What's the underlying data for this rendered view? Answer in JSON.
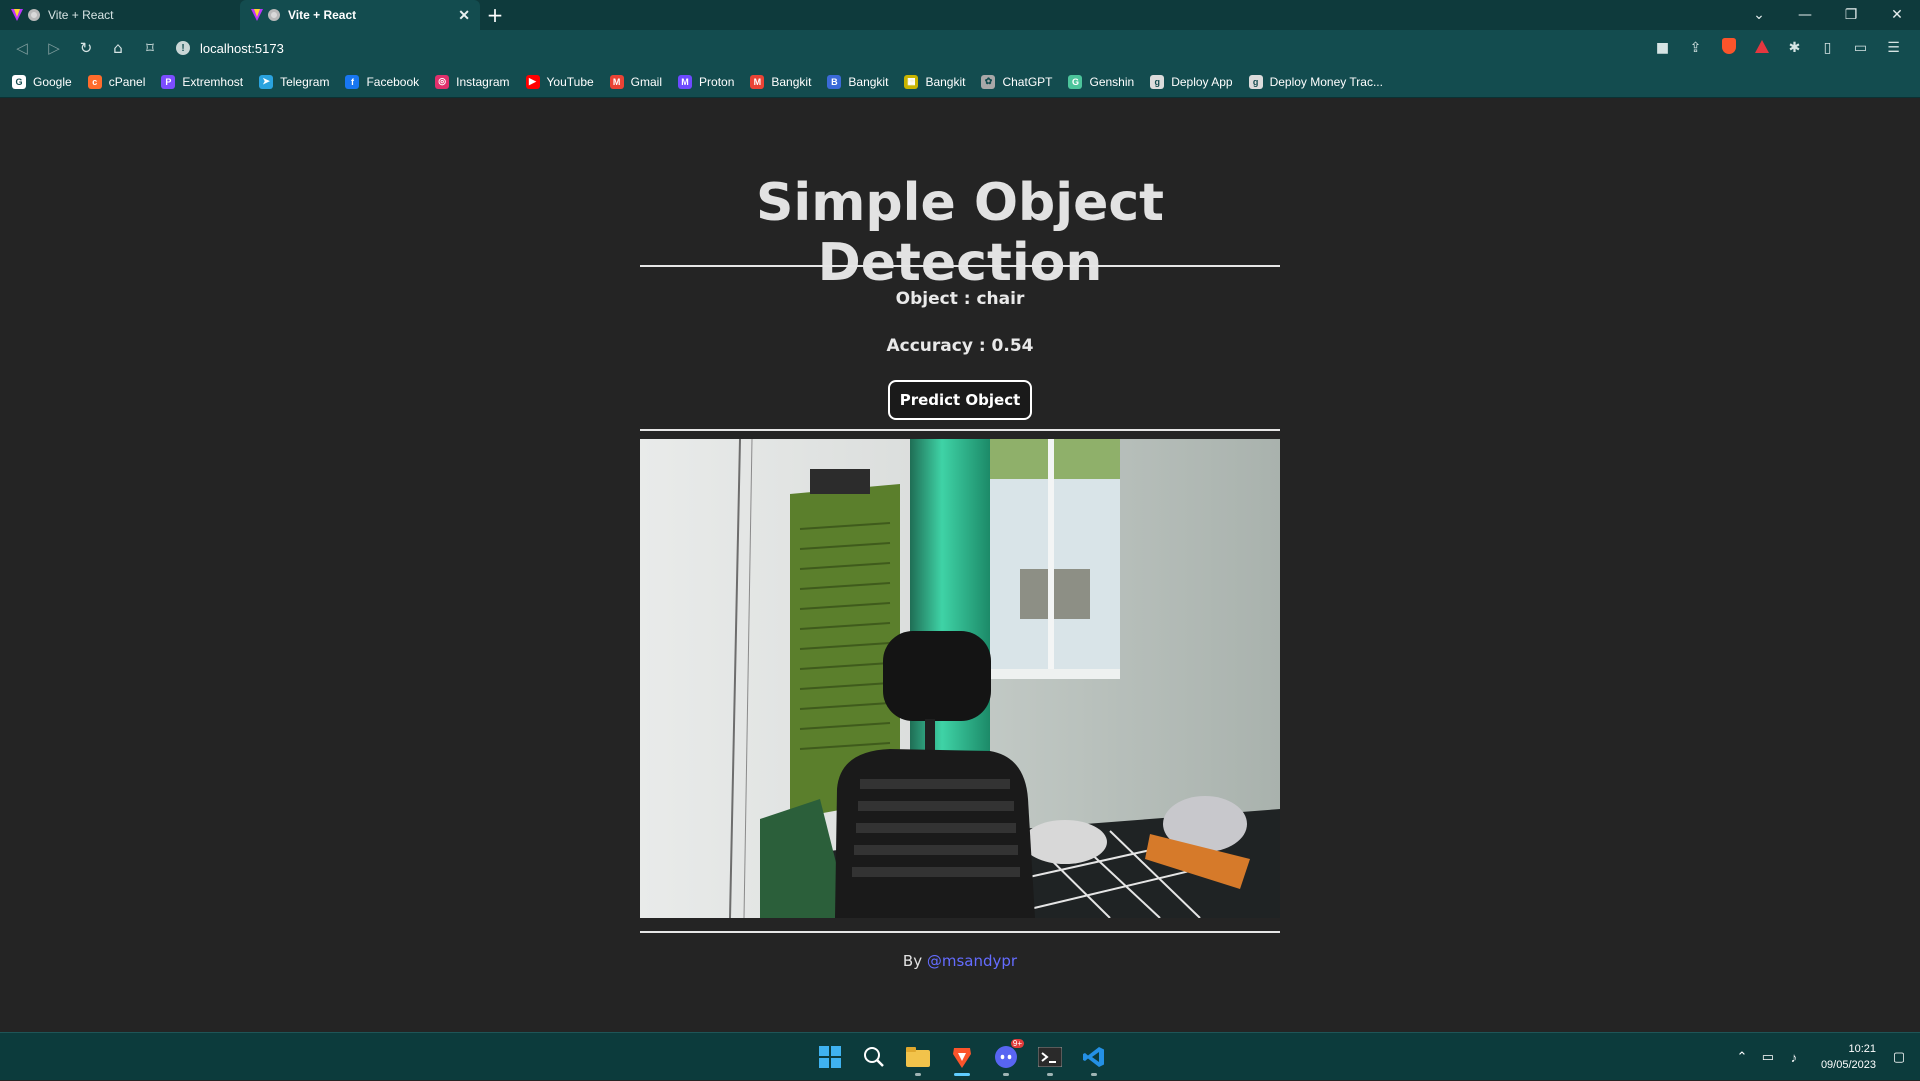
{
  "browser": {
    "tabs": [
      {
        "title": "Vite + React",
        "active": false
      },
      {
        "title": "Vite + React",
        "active": true
      }
    ],
    "address": "localhost:5173",
    "bookmarks": [
      {
        "label": "Google",
        "icon": "google-icon",
        "color": "#ffffff"
      },
      {
        "label": "cPanel",
        "icon": "cpanel-icon",
        "color": "#ff6c2c"
      },
      {
        "label": "Extremhost",
        "icon": "extremhost-icon",
        "color": "#7c4dff"
      },
      {
        "label": "Telegram",
        "icon": "telegram-icon",
        "color": "#2aa3df"
      },
      {
        "label": "Facebook",
        "icon": "facebook-icon",
        "color": "#1877f2"
      },
      {
        "label": "Instagram",
        "icon": "instagram-icon",
        "color": "#e1306c"
      },
      {
        "label": "YouTube",
        "icon": "youtube-icon",
        "color": "#ff0000"
      },
      {
        "label": "Gmail",
        "icon": "gmail-icon",
        "color": "#ea4335"
      },
      {
        "label": "Proton",
        "icon": "proton-icon",
        "color": "#6d4aff"
      },
      {
        "label": "Bangkit",
        "icon": "gmail-icon",
        "color": "#ea4335"
      },
      {
        "label": "Bangkit",
        "icon": "bangkit-icon",
        "color": "#3b6ad8"
      },
      {
        "label": "Bangkit",
        "icon": "bangkit-sheet-icon",
        "color": "#c9b400"
      },
      {
        "label": "ChatGPT",
        "icon": "chatgpt-icon",
        "color": "#a8a8a8"
      },
      {
        "label": "Genshin",
        "icon": "genshin-icon",
        "color": "#4cc49b"
      },
      {
        "label": "Deploy App",
        "icon": "deploy-icon",
        "color": "#dcdcdc"
      },
      {
        "label": "Deploy Money Trac...",
        "icon": "deploy-icon",
        "color": "#dcdcdc"
      }
    ]
  },
  "page": {
    "title": "Simple Object Detection",
    "object_line": "Object : chair",
    "accuracy_line": "Accuracy : 0.54",
    "predict_button": "Predict Object",
    "footer_prefix": "By ",
    "footer_link": "@msandypr"
  },
  "taskbar": {
    "time": "10:21",
    "date": "09/05/2023",
    "discord_badge": "9+"
  },
  "colors": {
    "page_bg": "#242424",
    "browser_frame": "#134c4f",
    "link": "#646cff",
    "taskbar": "#0c3b3c"
  }
}
